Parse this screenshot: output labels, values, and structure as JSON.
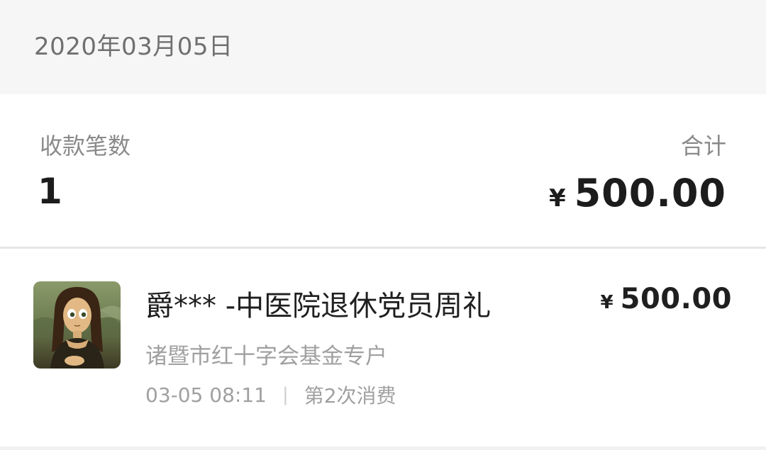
{
  "header": {
    "date": "2020年03月05日"
  },
  "summary": {
    "count_label": "收款笔数",
    "count_value": "1",
    "total_label": "合计",
    "currency_symbol": "¥",
    "total_value": "500.00"
  },
  "transactions": [
    {
      "avatar_icon": "mona-lisa-cartoon-avatar",
      "title": "爵*** -中医院退休党员周礼",
      "currency_symbol": "¥",
      "amount": "500.00",
      "account": "诸暨市红十字会基金专户",
      "time": "03-05 08:11",
      "separator": "|",
      "note": "第2次消费"
    }
  ],
  "colors": {
    "header_bg": "#f6f6f6",
    "label_gray": "#8a8a8a",
    "text_dark": "#1c1c1c",
    "divider": "#e6e6e6"
  }
}
